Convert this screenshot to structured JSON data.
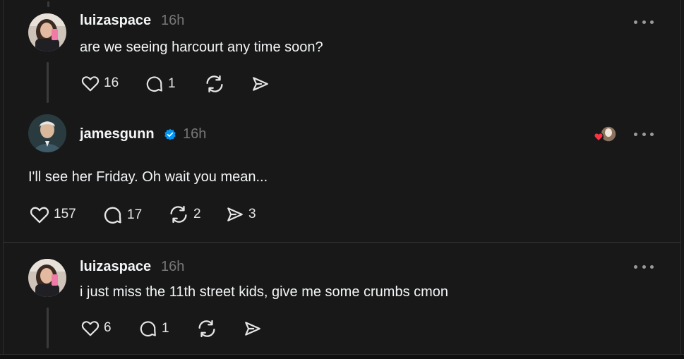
{
  "posts": [
    {
      "username": "luizaspace",
      "time": "16h",
      "text": "are we seeing harcourt any time soon?",
      "likes": "16",
      "replies": "1",
      "reposts": "",
      "shares": ""
    },
    {
      "username": "jamesgunn",
      "time": "16h",
      "text": "I'll see her Friday. Oh wait you mean...",
      "likes": "157",
      "replies": "17",
      "reposts": "2",
      "shares": "3"
    },
    {
      "username": "luizaspace",
      "time": "16h",
      "text": "i just miss the 11th street kids, give me some crumbs cmon",
      "likes": "6",
      "replies": "1",
      "reposts": "",
      "shares": ""
    }
  ],
  "colors": {
    "background": "#181818",
    "verified": "#0095f6",
    "liked_heart": "#ff3040",
    "muted_text": "#777777"
  },
  "icons": [
    "heart-icon",
    "comment-icon",
    "repost-icon",
    "share-icon",
    "more-icon",
    "verified-badge-icon"
  ]
}
